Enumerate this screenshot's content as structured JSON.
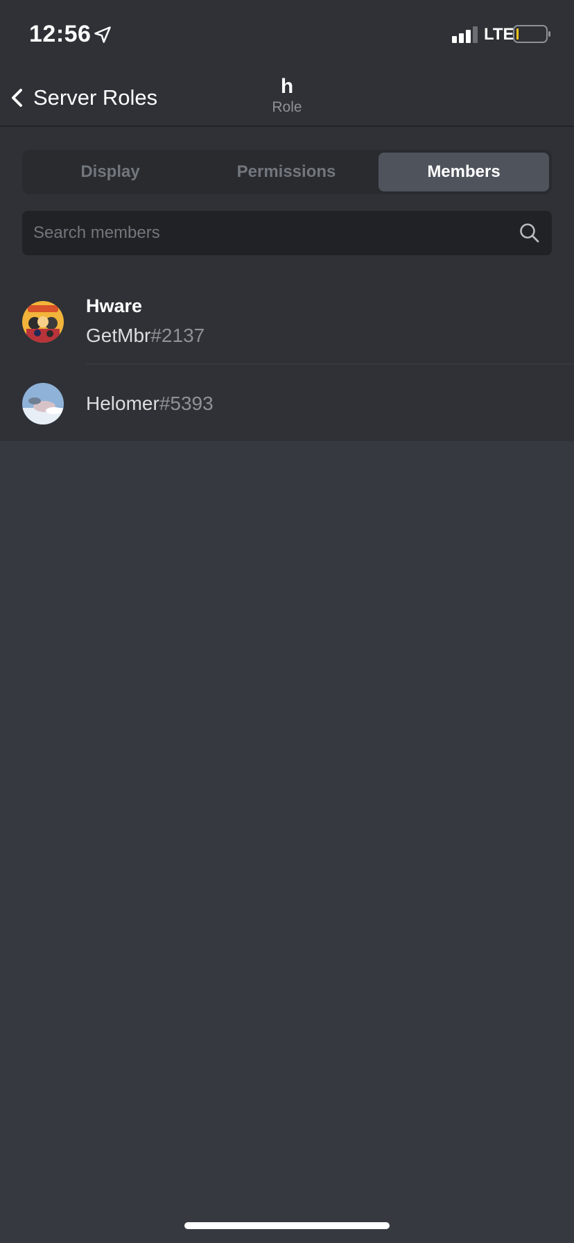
{
  "status_bar": {
    "time": "12:56",
    "network": "LTE",
    "icons": [
      "location-arrow-icon",
      "signal-icon",
      "battery-icon"
    ]
  },
  "header": {
    "back_label": "Server Roles",
    "title": "h",
    "subtitle": "Role"
  },
  "tabs": [
    {
      "label": "Display",
      "selected": false
    },
    {
      "label": "Permissions",
      "selected": false
    },
    {
      "label": "Members",
      "selected": true
    }
  ],
  "search": {
    "placeholder": "Search members",
    "value": ""
  },
  "members": [
    {
      "display_name": "Hware",
      "username": "GetMbr",
      "discriminator": "#2137",
      "avatar": "anime-characters-avatar"
    },
    {
      "display_name": "",
      "username": "Helomer",
      "discriminator": "#5393",
      "avatar": "sky-cat-avatar"
    }
  ],
  "colors": {
    "background": "#36393f",
    "header_bg": "#2f3136",
    "selected_tab": "#4f545c",
    "search_bg": "#202225"
  }
}
